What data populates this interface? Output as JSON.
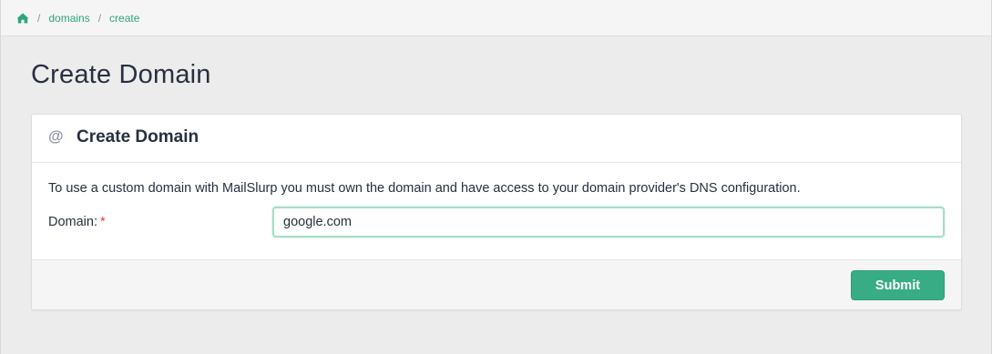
{
  "breadcrumb": {
    "home_icon": "home-icon",
    "separator": "/",
    "items": [
      {
        "label": "domains"
      },
      {
        "label": "create"
      }
    ]
  },
  "page": {
    "title": "Create Domain"
  },
  "card": {
    "icon": "@",
    "title": "Create Domain",
    "help_text": "To use a custom domain with MailSlurp you must own the domain and have access to your domain provider's DNS configuration.",
    "form": {
      "domain_label": "Domain:",
      "required_mark": "*",
      "domain_value": "google.com",
      "domain_placeholder": ""
    },
    "submit_label": "Submit"
  },
  "colors": {
    "accent": "#38ad85",
    "link": "#2fa57d",
    "required": "#d6433f",
    "background": "#edeced"
  }
}
